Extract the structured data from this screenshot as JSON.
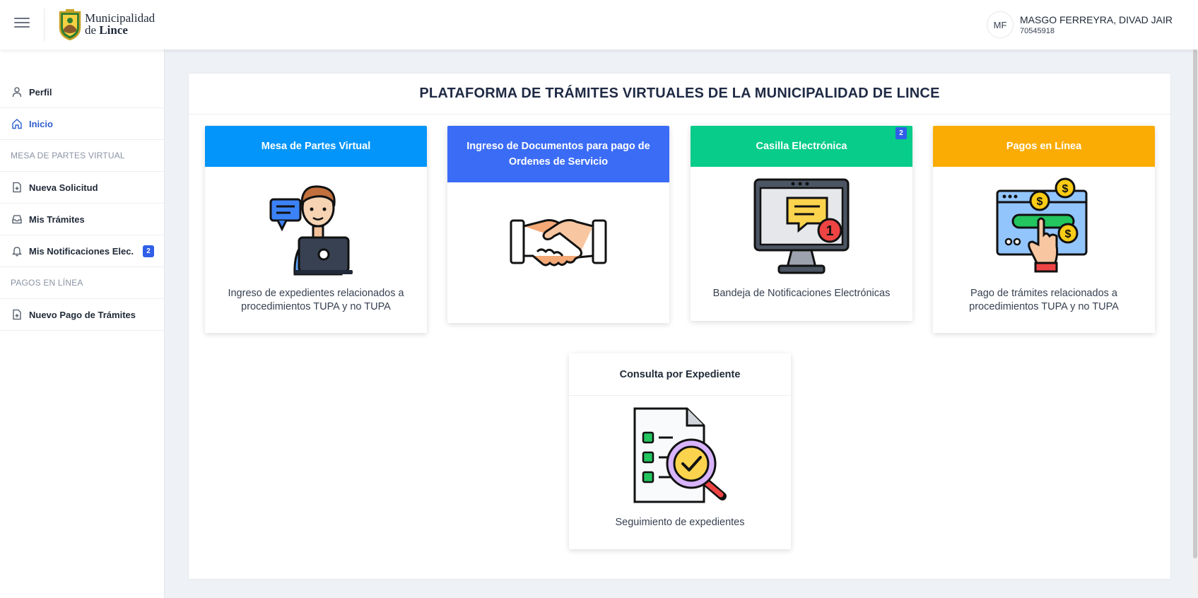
{
  "header": {
    "logo": {
      "line1": "Municipalidad",
      "line2_prefix": "de ",
      "line2_bold": "Lince"
    },
    "user": {
      "initials": "MF",
      "name": "MASGO FERREYRA, DIVAD JAIR",
      "id": "70545918"
    }
  },
  "sidebar": {
    "items": [
      {
        "label": "Perfil",
        "icon": "user-icon"
      },
      {
        "label": "Inicio",
        "icon": "home-icon",
        "active": true
      },
      {
        "section": "MESA DE PARTES VIRTUAL"
      },
      {
        "label": "Nueva Solicitud",
        "icon": "file-plus-icon"
      },
      {
        "label": "Mis Trámites",
        "icon": "inbox-icon"
      },
      {
        "label": "Mis Notificaciones Elec.",
        "icon": "bell-icon",
        "badge": "2"
      },
      {
        "section": "PAGOS EN LÍNEA"
      },
      {
        "label": "Nuevo Pago de Trámites",
        "icon": "file-plus-icon"
      }
    ]
  },
  "main": {
    "title": "PLATAFORMA DE TRÁMITES VIRTUALES DE LA MUNICIPALIDAD DE LINCE",
    "cards": [
      {
        "title": "Mesa de Partes Virtual",
        "description": "Ingreso de expedientes relacionados a procedimientos TUPA y no TUPA",
        "color": "#0395f9",
        "icon": "person-laptop-icon"
      },
      {
        "title": "Ingreso de Documentos para pago de Ordenes de Servicio",
        "description": "",
        "color": "#3b6cf6",
        "icon": "handshake-icon"
      },
      {
        "title": "Casilla Electrónica",
        "description": "Bandeja de Notificaciones Electrónicas",
        "color": "#07cc8a",
        "icon": "monitor-notification-icon",
        "badge": "2"
      },
      {
        "title": "Pagos en Línea",
        "description": "Pago de trámites relacionados a procedimientos TUPA y no TUPA",
        "color": "#fbac04",
        "icon": "online-payment-icon"
      },
      {
        "title": "Consulta por Expediente",
        "description": "Seguimiento de expedientes",
        "color": "#ffffff",
        "icon": "document-search-icon"
      }
    ]
  }
}
